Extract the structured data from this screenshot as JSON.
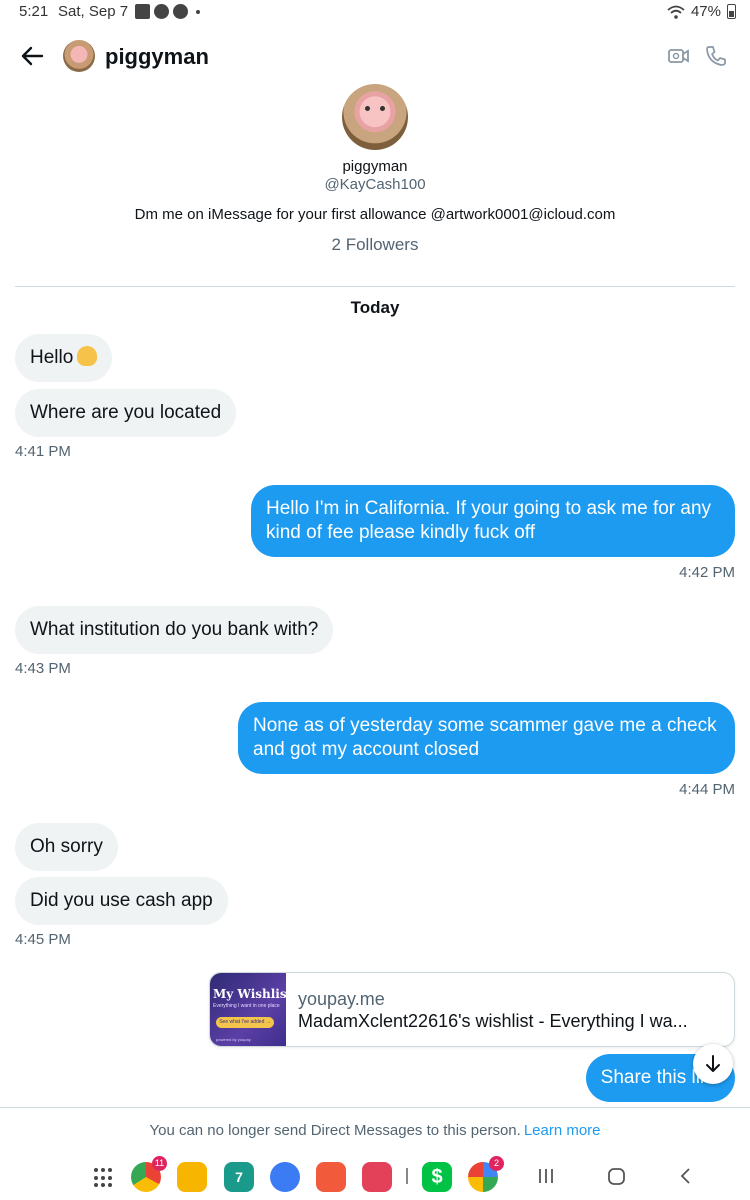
{
  "status_bar": {
    "time": "5:21",
    "date": "Sat, Sep 7",
    "battery": "47%"
  },
  "header": {
    "name": "piggyman"
  },
  "profile": {
    "name": "piggyman",
    "handle": "@KayCash100",
    "bio": "Dm me on iMessage for your first allowance @artwork0001@icloud.com",
    "followers": "2 Followers"
  },
  "day_label": "Today",
  "messages": {
    "m1": "Hello",
    "m2": "Where are you located",
    "t1": "4:41 PM",
    "m3_line1": "Hello I'm in California. If your going to ask me for any",
    "m3_line2": "kind of fee please kindly fuck off",
    "t2": "4:42 PM",
    "m4": "What institution do you bank with?",
    "t3": "4:43 PM",
    "m5_line1": "None as of yesterday some scammer gave me a check",
    "m5_line2": "and got my account closed",
    "t4": "4:44 PM",
    "m6": "Oh sorry",
    "m7": "Did you use cash app",
    "t5": "4:45 PM",
    "m8": "Share this link"
  },
  "link_card": {
    "domain": "youpay.me",
    "title": "MadamXclent22616's wishlist - Everything I wa...",
    "thumb_title": "My Wishlist",
    "thumb_sub": "Everything I want in one place",
    "thumb_button": "See what I've added →",
    "thumb_powered": "powered by youpay"
  },
  "notice": {
    "text": "You can no longer send Direct Messages to this person.",
    "link": "Learn more"
  },
  "dock": {
    "chrome_badge": "11",
    "calendar_day": "7",
    "google_badge": "2"
  }
}
